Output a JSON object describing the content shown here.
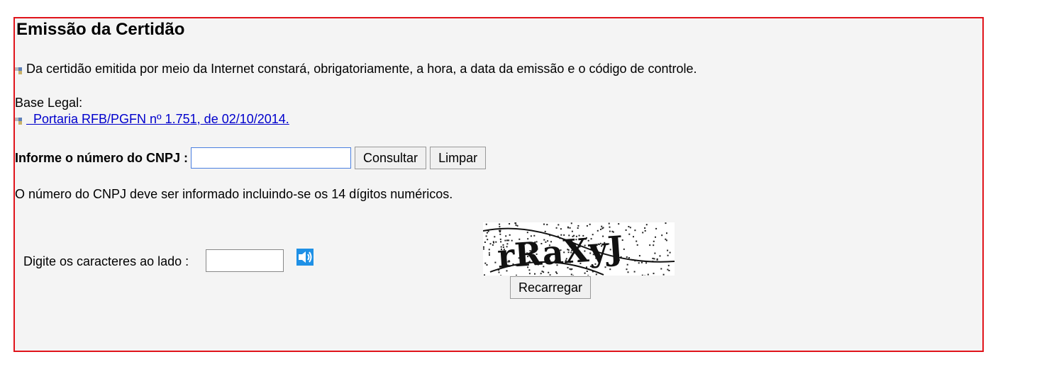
{
  "section": {
    "title": "Emissão da Certidão",
    "notice": "Da certidão emitida por meio da Internet constará, obrigatoriamente, a hora, a data da emissão e o código de controle.",
    "base_legal_label": "Base Legal:",
    "base_legal_link": "Portaria RFB/PGFN nº 1.751, de 02/10/2014."
  },
  "cnpj_form": {
    "label": "Informe o número do CNPJ :",
    "input_value": "",
    "consultar_label": "Consultar",
    "limpar_label": "Limpar",
    "info": "O número do CNPJ deve ser informado incluindo-se os 14 dígitos numéricos."
  },
  "captcha": {
    "label": "Digite os caracteres ao lado :",
    "input_value": "",
    "audio_icon": "speaker-icon",
    "image_text": "rRaXyJ",
    "reload_label": "Recarregar"
  },
  "colors": {
    "panel_border": "#e0141b",
    "panel_background": "#f4f4f4",
    "link": "#0000cc",
    "audio_icon": "#1e90e6"
  }
}
